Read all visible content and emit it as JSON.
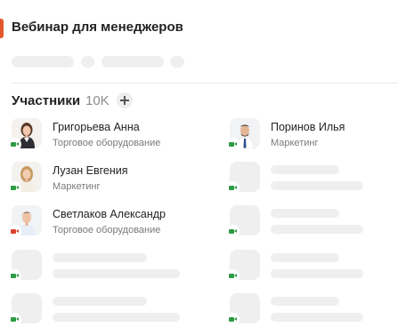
{
  "header": {
    "title": "Вебинар для менеджеров",
    "accent_color": "#e2572b"
  },
  "participants": {
    "title": "Участники",
    "count": "10K"
  },
  "colors": {
    "camera_on": "#2e9b45",
    "camera_off": "#d9442f",
    "skeleton": "#efefef"
  },
  "list": [
    {
      "name": "Григорьева Анна",
      "role": "Торговое оборудование",
      "camera": "on",
      "avatar": "woman-photo"
    },
    {
      "name": "Поринов Илья",
      "role": "Маркетинг",
      "camera": "on",
      "avatar": "man-beard-photo"
    },
    {
      "name": "Лузан Евгения",
      "role": "Маркетинг",
      "camera": "on",
      "avatar": "woman-blonde-photo"
    },
    {
      "name": "Светлаков Александр",
      "role": "Торговое оборудование",
      "camera": "off",
      "avatar": "man-shirt-photo"
    }
  ]
}
